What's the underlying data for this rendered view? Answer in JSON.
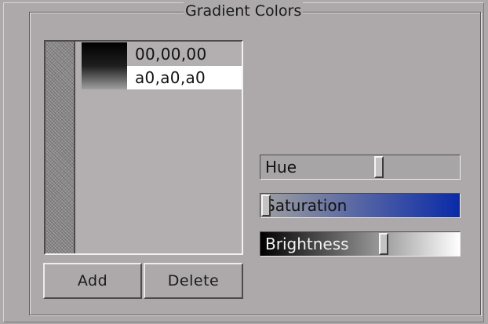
{
  "group": {
    "title": "Gradient Colors"
  },
  "colors": [
    {
      "label": "00,00,00",
      "swatch_top": "#000000",
      "swatch_bottom": "#1e1e1e",
      "selected": false
    },
    {
      "label": "a0,a0,a0",
      "swatch_top": "#1e1e1e",
      "swatch_bottom": "#a0a0a0",
      "selected": true
    }
  ],
  "buttons": {
    "add_label": "Add",
    "delete_label": "Delete"
  },
  "sliders": {
    "hue": {
      "label": "Hue",
      "value_fraction": 0.6,
      "background": "#a8a5a6"
    },
    "saturation": {
      "label": "Saturation",
      "value_fraction": 0.0,
      "gradient_start": "#a0a0a0",
      "gradient_end": "#0a2aa8"
    },
    "brightness": {
      "label": "Brightness",
      "value_fraction": 0.627,
      "gradient_start": "#000000",
      "gradient_end": "#ffffff"
    }
  }
}
